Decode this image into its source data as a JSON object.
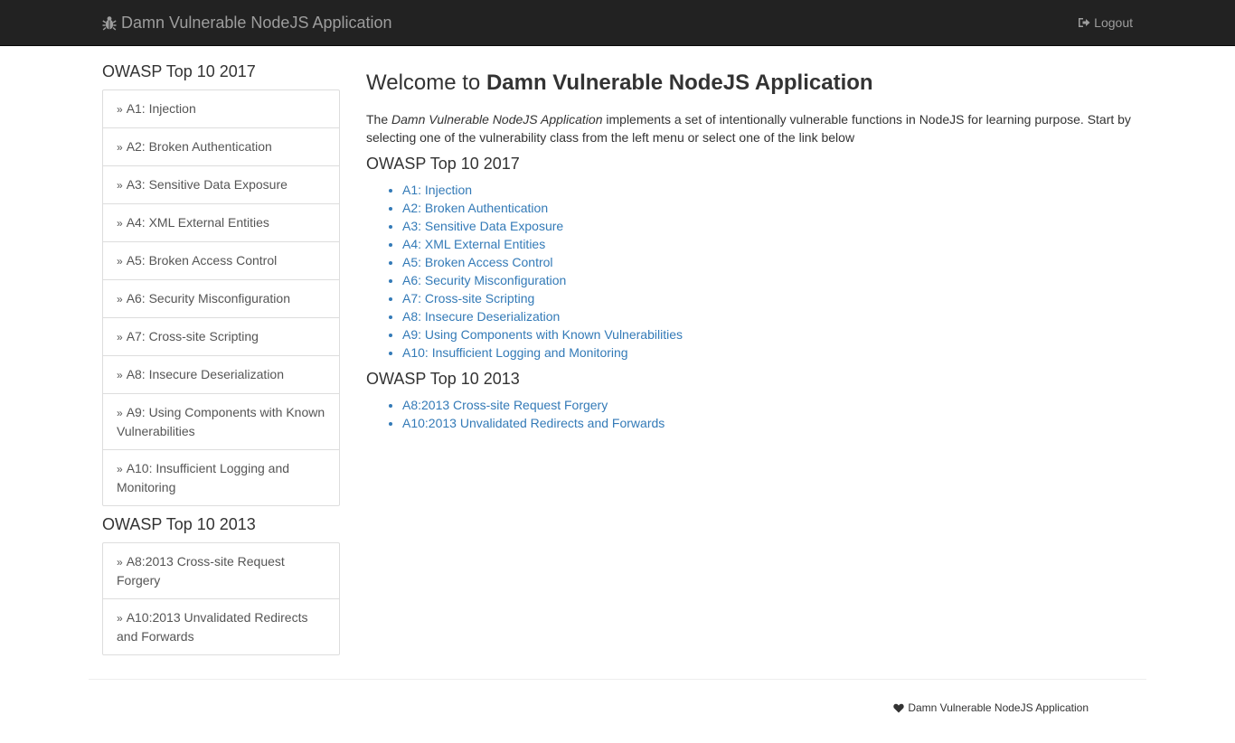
{
  "navbar": {
    "brand": "Damn Vulnerable NodeJS Application",
    "brand_icon": "bug-icon",
    "logout_label": "Logout",
    "logout_icon": "sign-out-icon"
  },
  "sidebar": {
    "heading_2017": "OWASP Top 10 2017",
    "items_2017": [
      {
        "label": "A1: Injection"
      },
      {
        "label": "A2: Broken Authentication"
      },
      {
        "label": "A3: Sensitive Data Exposure"
      },
      {
        "label": "A4: XML External Entities"
      },
      {
        "label": "A5: Broken Access Control"
      },
      {
        "label": "A6: Security Misconfiguration"
      },
      {
        "label": "A7: Cross-site Scripting"
      },
      {
        "label": "A8: Insecure Deserialization"
      },
      {
        "label": "A9: Using Components with Known Vulnerabilities"
      },
      {
        "label": "A10: Insufficient Logging and Monitoring"
      }
    ],
    "heading_2013": "OWASP Top 10 2013",
    "items_2013": [
      {
        "label": "A8:2013 Cross-site Request Forgery"
      },
      {
        "label": "A10:2013 Unvalidated Redirects and Forwards"
      }
    ]
  },
  "main": {
    "welcome_prefix": "Welcome to ",
    "welcome_app": "Damn Vulnerable NodeJS Application",
    "intro_the": "The ",
    "intro_app": "Damn Vulnerable NodeJS Application",
    "intro_rest": " implements a set of intentionally vulnerable functions in NodeJS for learning purpose. Start by selecting one of the vulnerability class from the left menu or select one of the link below",
    "heading_2017": "OWASP Top 10 2017",
    "links_2017": [
      {
        "label": "A1: Injection"
      },
      {
        "label": "A2: Broken Authentication"
      },
      {
        "label": "A3: Sensitive Data Exposure"
      },
      {
        "label": "A4: XML External Entities"
      },
      {
        "label": "A5: Broken Access Control"
      },
      {
        "label": "A6: Security Misconfiguration"
      },
      {
        "label": "A7: Cross-site Scripting"
      },
      {
        "label": "A8: Insecure Deserialization"
      },
      {
        "label": "A9: Using Components with Known Vulnerabilities"
      },
      {
        "label": "A10: Insufficient Logging and Monitoring"
      }
    ],
    "heading_2013": "OWASP Top 10 2013",
    "links_2013": [
      {
        "label": "A8:2013 Cross-site Request Forgery"
      },
      {
        "label": "A10:2013 Unvalidated Redirects and Forwards"
      }
    ]
  },
  "footer": {
    "text": "Damn Vulnerable NodeJS Application",
    "icon": "heart-icon"
  },
  "colors": {
    "navbar_bg": "#222222",
    "navbar_text": "#9d9d9d",
    "link": "#337ab7",
    "border": "#dddddd"
  }
}
